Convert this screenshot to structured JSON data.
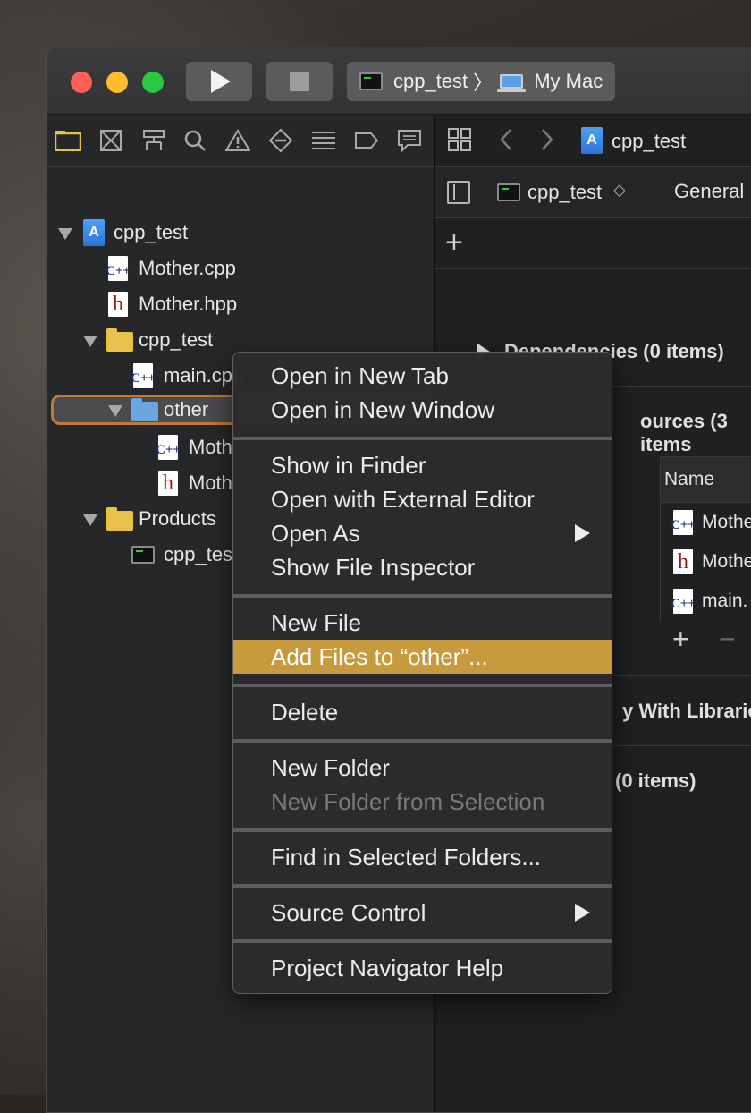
{
  "toolbar": {
    "scheme_name": "cpp_test",
    "scheme_separator": "〉",
    "destination": "My Mac"
  },
  "navigator": {
    "items": [
      {
        "label": "cpp_test",
        "kind": "project"
      },
      {
        "label": "Mother.cpp",
        "kind": "cpp"
      },
      {
        "label": "Mother.hpp",
        "kind": "h"
      },
      {
        "label": "cpp_test",
        "kind": "folder"
      },
      {
        "label": "main.cpp",
        "kind": "cpp"
      },
      {
        "label": "other",
        "kind": "folder-blue"
      },
      {
        "label": "Moth",
        "kind": "cpp"
      },
      {
        "label": "Moth",
        "kind": "h"
      },
      {
        "label": "Products",
        "kind": "folder"
      },
      {
        "label": "cpp_tes",
        "kind": "exec"
      }
    ]
  },
  "editor": {
    "jumpbar_title": "cpp_test",
    "target_name": "cpp_test",
    "target_stepper": "◇",
    "tab_general": "General",
    "dependencies": "Dependencies (0 items)",
    "compile_sources": "ources (3 items",
    "table_header_name": "Name",
    "table_rows": [
      "Mothe",
      "Mothe",
      "main."
    ],
    "link_with_libraries": "y With Librarie",
    "copy_bundle": "(0 items)"
  },
  "context_menu": {
    "groups": [
      [
        "Open in New Tab",
        "Open in New Window"
      ],
      [
        "Show in Finder",
        "Open with External Editor",
        "Open As",
        "Show File Inspector"
      ],
      [
        "New File",
        "Add Files to “other”..."
      ],
      [
        "Delete"
      ],
      [
        "New Folder",
        "New Folder from Selection"
      ],
      [
        "Find in Selected Folders..."
      ],
      [
        "Source Control"
      ],
      [
        "Project Navigator Help"
      ]
    ],
    "highlighted": "Add Files to “other”...",
    "disabled": [
      "New Folder from Selection"
    ],
    "submenus": [
      "Open As",
      "Source Control"
    ]
  },
  "colors": {
    "highlight": "#c69a3d",
    "selection_ring": "#c27b34",
    "traffic_red": "#fe5f57",
    "traffic_yellow": "#febc2e",
    "traffic_green": "#28c840"
  }
}
